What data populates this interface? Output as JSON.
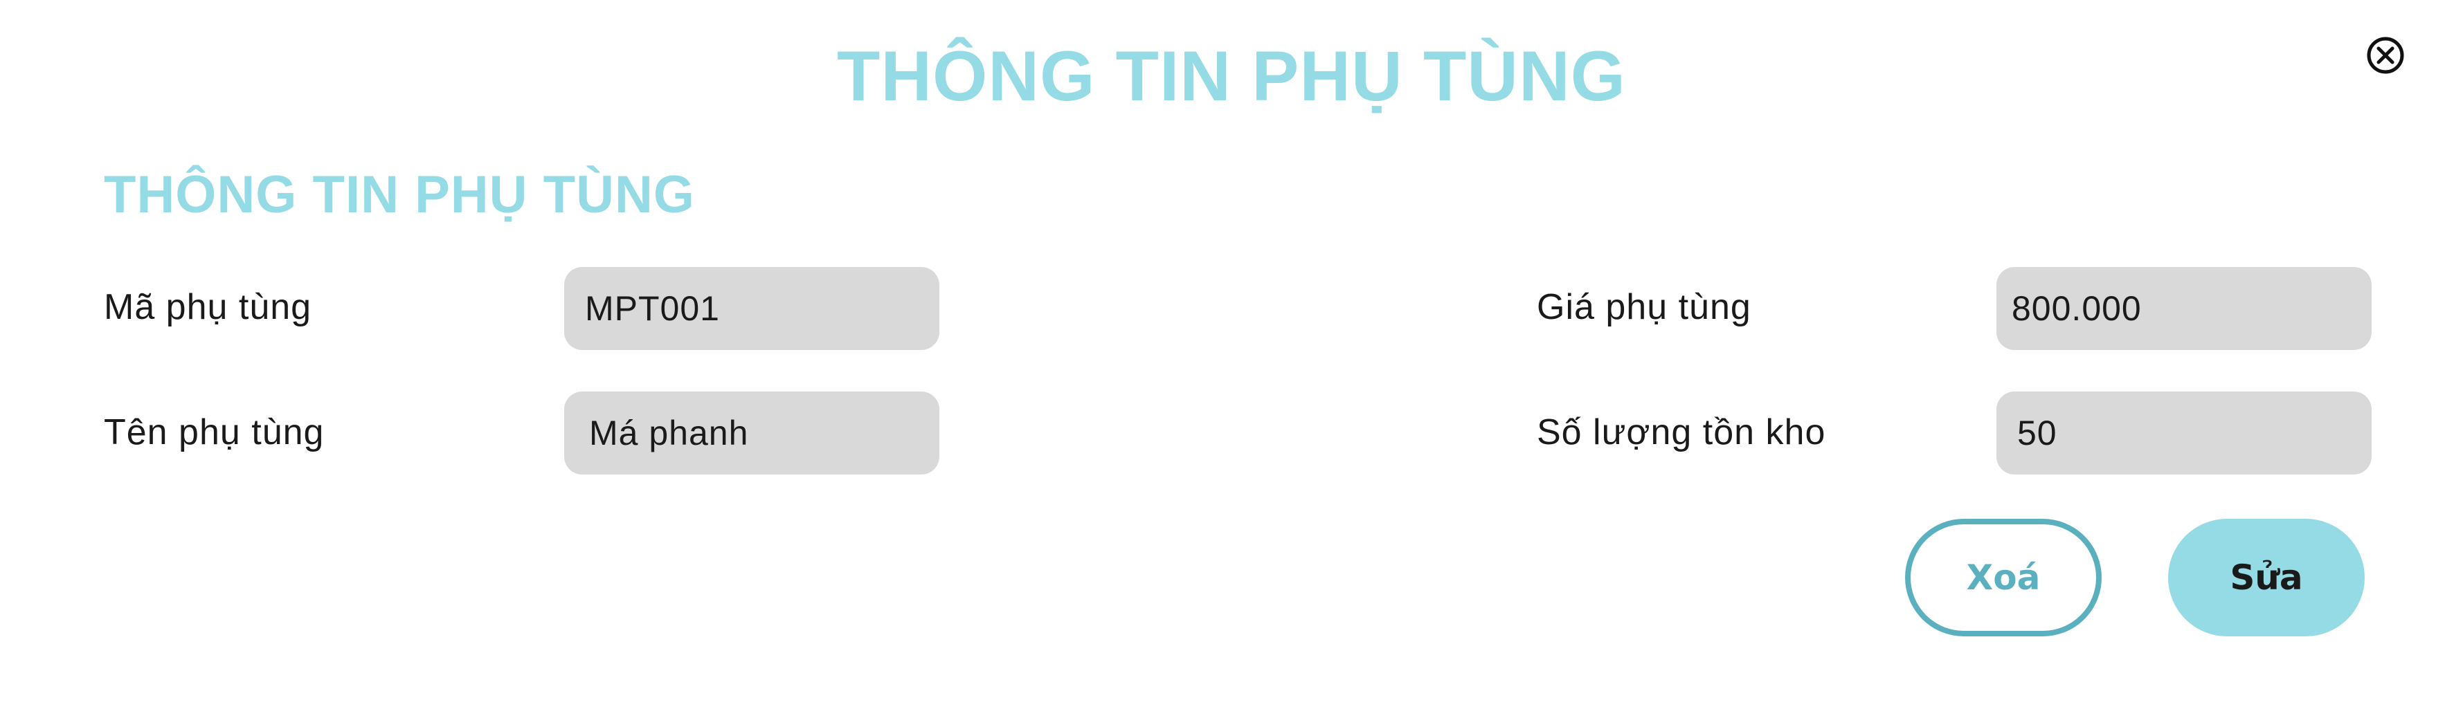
{
  "modal": {
    "title": "THÔNG TIN PHỤ TÙNG",
    "close_icon": "close-circle-icon"
  },
  "section": {
    "title": "THÔNG TIN PHỤ TÙNG"
  },
  "fields": {
    "part_code": {
      "label": "Mã phụ tùng",
      "value": "MPT001"
    },
    "part_name": {
      "label": "Tên phụ tùng",
      "value": "Má phanh"
    },
    "part_price": {
      "label": "Giá phụ tùng",
      "value": "800.000"
    },
    "stock_quantity": {
      "label": "Số lượng tồn kho",
      "value": "50"
    }
  },
  "actions": {
    "delete_label": "Xoá",
    "edit_label": "Sửa"
  },
  "colors": {
    "accent": "#95dbe5",
    "accent_dark": "#5ab0bf",
    "input_bg": "#d9d9d9",
    "text": "#1a1a1a"
  }
}
